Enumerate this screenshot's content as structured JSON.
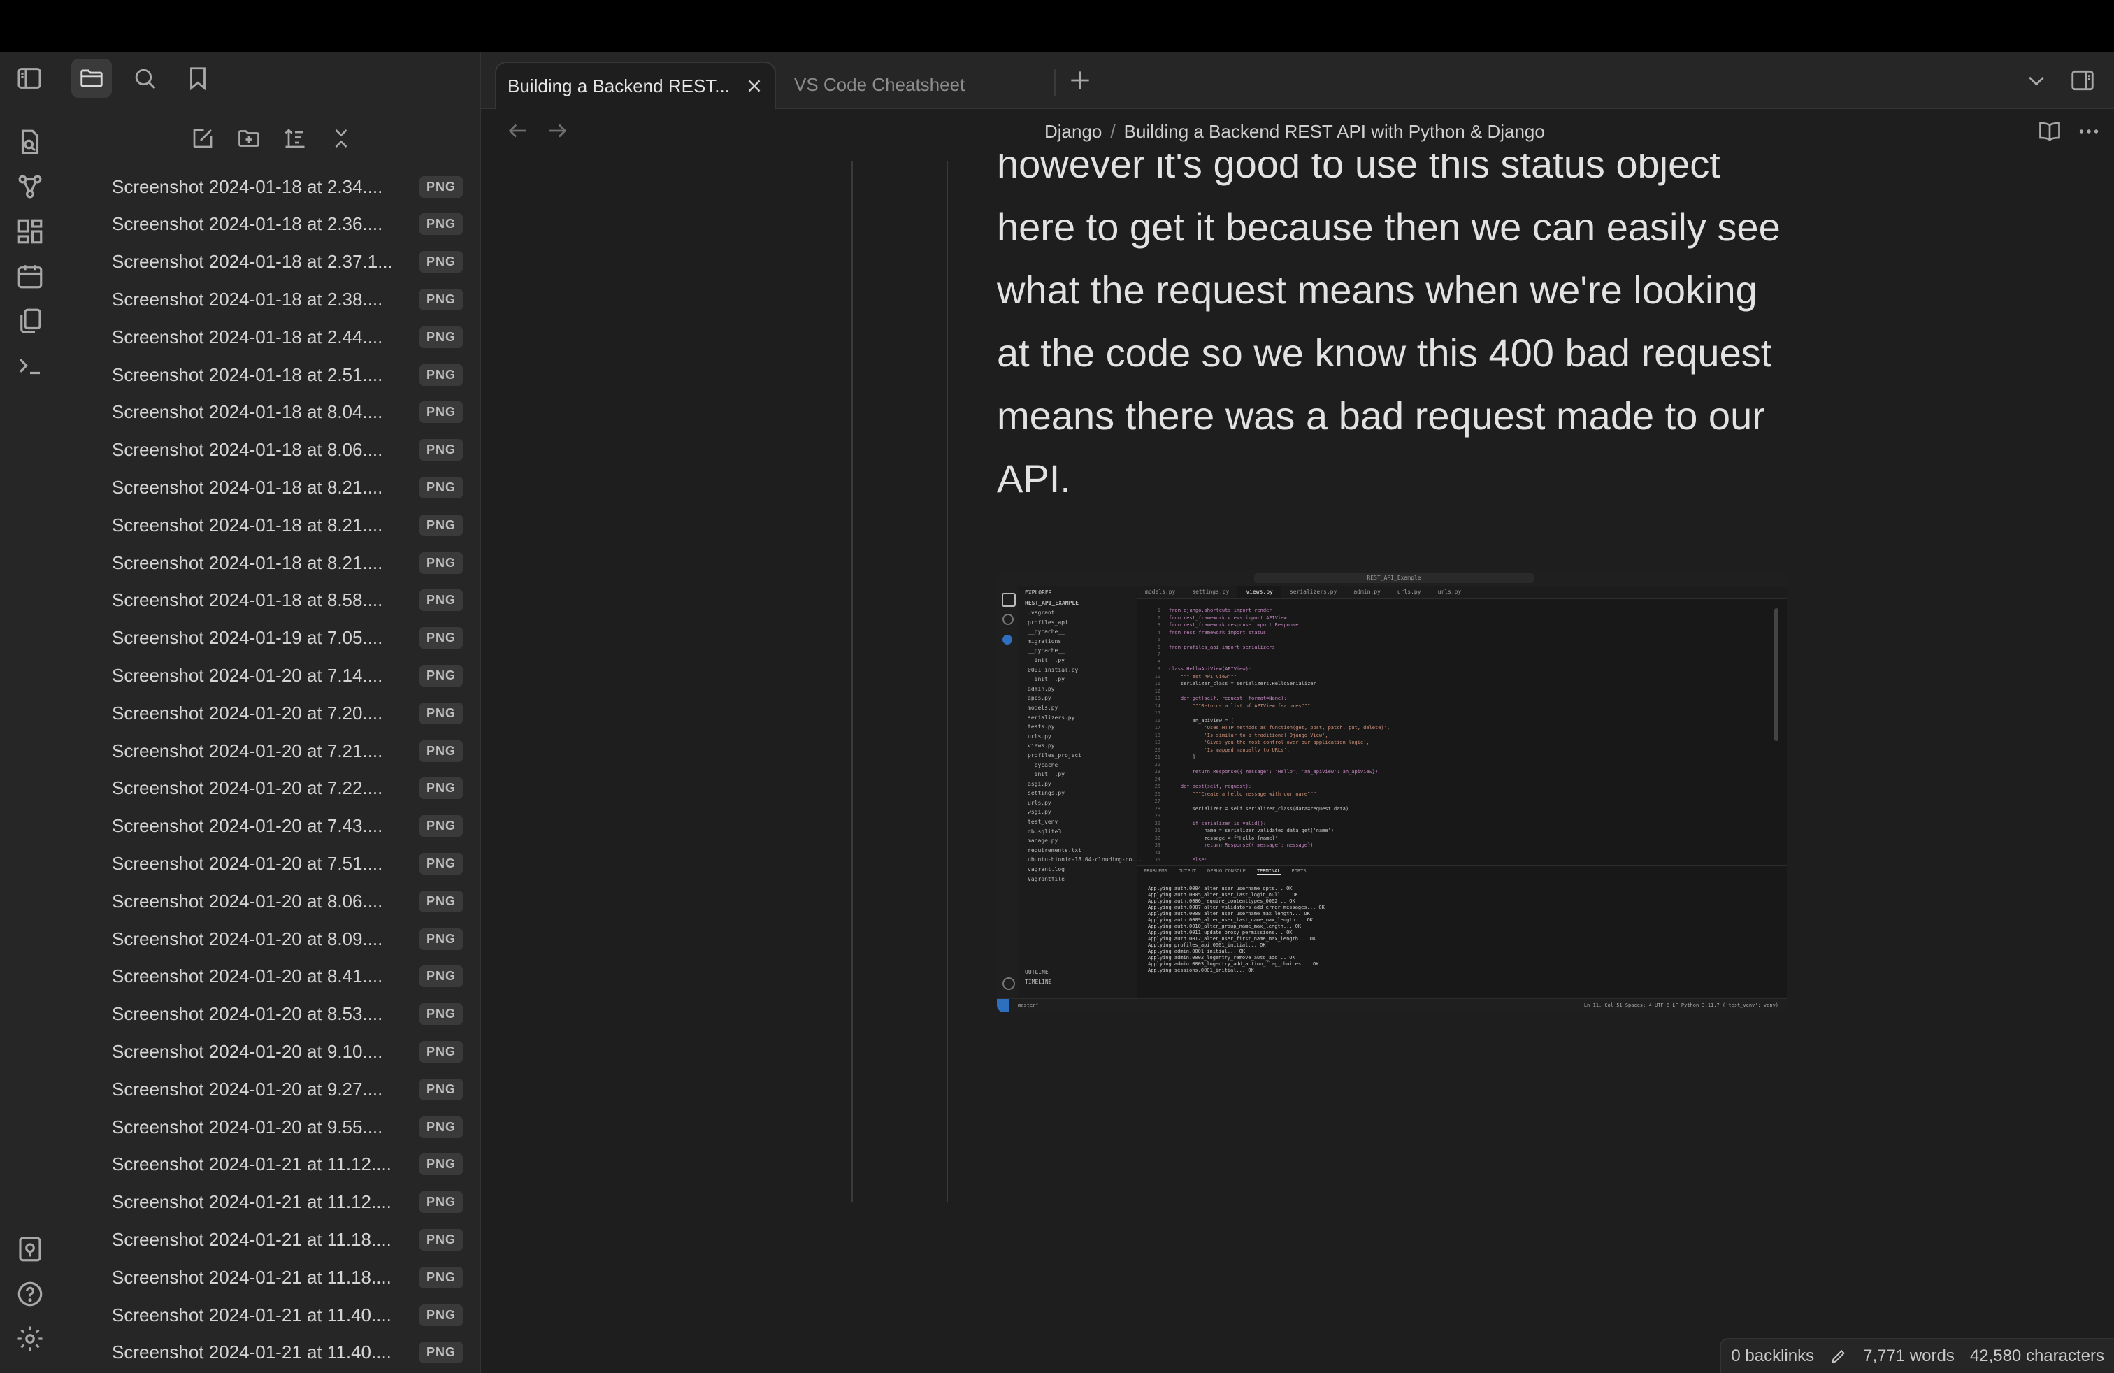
{
  "tabs": {
    "active_title": "Building a Backend REST...",
    "inactive_title": "VS Code Cheatsheet"
  },
  "breadcrumb": {
    "folder": "Django",
    "separator": "/",
    "note": "Building a Backend REST API with Python & Django"
  },
  "ribbon": {
    "top_icons": [
      "open-quick-switcher-icon",
      "graph-view-icon",
      "canvas-icon",
      "daily-note-icon",
      "templates-icon",
      "terminal-icon"
    ],
    "bottom_icons": [
      "vault-switch-icon",
      "help-icon",
      "settings-icon"
    ]
  },
  "sidebar": {
    "nav_icons": [
      "files-icon",
      "search-icon",
      "bookmark-icon"
    ],
    "toolbar_icons": [
      "new-note-icon",
      "new-folder-icon",
      "sort-icon",
      "collapse-all-icon"
    ],
    "files": [
      {
        "name": "Screenshot 2024-01-18 at 2.34....",
        "ext": "PNG"
      },
      {
        "name": "Screenshot 2024-01-18 at 2.36....",
        "ext": "PNG"
      },
      {
        "name": "Screenshot 2024-01-18 at 2.37.1...",
        "ext": "PNG"
      },
      {
        "name": "Screenshot 2024-01-18 at 2.38....",
        "ext": "PNG"
      },
      {
        "name": "Screenshot 2024-01-18 at 2.44....",
        "ext": "PNG"
      },
      {
        "name": "Screenshot 2024-01-18 at 2.51....",
        "ext": "PNG"
      },
      {
        "name": "Screenshot 2024-01-18 at 8.04....",
        "ext": "PNG"
      },
      {
        "name": "Screenshot 2024-01-18 at 8.06....",
        "ext": "PNG"
      },
      {
        "name": "Screenshot 2024-01-18 at 8.21....",
        "ext": "PNG"
      },
      {
        "name": "Screenshot 2024-01-18 at 8.21....",
        "ext": "PNG"
      },
      {
        "name": "Screenshot 2024-01-18 at 8.21....",
        "ext": "PNG"
      },
      {
        "name": "Screenshot 2024-01-18 at 8.58....",
        "ext": "PNG"
      },
      {
        "name": "Screenshot 2024-01-19 at 7.05....",
        "ext": "PNG"
      },
      {
        "name": "Screenshot 2024-01-20 at 7.14....",
        "ext": "PNG"
      },
      {
        "name": "Screenshot 2024-01-20 at 7.20....",
        "ext": "PNG"
      },
      {
        "name": "Screenshot 2024-01-20 at 7.21....",
        "ext": "PNG"
      },
      {
        "name": "Screenshot 2024-01-20 at 7.22....",
        "ext": "PNG"
      },
      {
        "name": "Screenshot 2024-01-20 at 7.43....",
        "ext": "PNG"
      },
      {
        "name": "Screenshot 2024-01-20 at 7.51....",
        "ext": "PNG"
      },
      {
        "name": "Screenshot 2024-01-20 at 8.06....",
        "ext": "PNG"
      },
      {
        "name": "Screenshot 2024-01-20 at 8.09....",
        "ext": "PNG"
      },
      {
        "name": "Screenshot 2024-01-20 at 8.41....",
        "ext": "PNG"
      },
      {
        "name": "Screenshot 2024-01-20 at 8.53....",
        "ext": "PNG"
      },
      {
        "name": "Screenshot 2024-01-20 at 9.10....",
        "ext": "PNG"
      },
      {
        "name": "Screenshot 2024-01-20 at 9.27....",
        "ext": "PNG"
      },
      {
        "name": "Screenshot 2024-01-20 at 9.55....",
        "ext": "PNG"
      },
      {
        "name": "Screenshot 2024-01-21 at 11.12....",
        "ext": "PNG"
      },
      {
        "name": "Screenshot 2024-01-21 at 11.12....",
        "ext": "PNG"
      },
      {
        "name": "Screenshot 2024-01-21 at 11.18....",
        "ext": "PNG"
      },
      {
        "name": "Screenshot 2024-01-21 at 11.18....",
        "ext": "PNG"
      },
      {
        "name": "Screenshot 2024-01-21 at 11.40....",
        "ext": "PNG"
      },
      {
        "name": "Screenshot 2024-01-21 at 11.40....",
        "ext": "PNG"
      }
    ]
  },
  "note": {
    "paragraph": "however it's good to use this status object here to get it because then we can easily see what the request means when we're looking at the code so we know this 400 bad request means there was a bad request made to our API."
  },
  "embedded_screenshot": {
    "window_title": "REST_API_Example",
    "explorer_title": "EXPLORER",
    "project_root": "REST_API_EXAMPLE",
    "editor_tabs": [
      "models.py",
      "settings.py",
      "views.py",
      "serializers.py",
      "admin.py",
      "urls.py",
      "urls.py"
    ],
    "tree": [
      ".vagrant",
      "profiles_api",
      "__pycache__",
      "migrations",
      "__pycache__",
      "__init__.py",
      "0001_initial.py",
      "__init__.py",
      "admin.py",
      "apps.py",
      "models.py",
      "serializers.py",
      "tests.py",
      "urls.py",
      "views.py",
      "profiles_project",
      "__pycache__",
      "__init__.py",
      "asgi.py",
      "settings.py",
      "urls.py",
      "wsgi.py",
      "test_venv",
      "db.sqlite3",
      "manage.py",
      "requirements.txt",
      "ubuntu-bionic-18.04-cloudimg-co...",
      "vagrant.log",
      "Vagrantfile"
    ],
    "code_lines": [
      "from django.shortcuts import render",
      "from rest_framework.views import APIView",
      "from rest_framework.response import Response",
      "from rest_framework import status",
      "",
      "from profiles_api import serializers",
      "",
      "",
      "class HelloApiView(APIView):",
      "    \"\"\"Test API View\"\"\"",
      "    serializer_class = serializers.HelloSerializer",
      "",
      "    def get(self, request, format=None):",
      "        \"\"\"Returns a list of APIView features\"\"\"",
      "",
      "        an_apiview = [",
      "            'Uses HTTP methods as function(get, post, patch, put, delete)',",
      "            'Is similar to a traditional Django View',",
      "            'Gives you the most control over our application logic',",
      "            'Is mapped manually to URLs',",
      "        ]",
      "",
      "        return Response({'message': 'Hello', 'an_apiview': an_apiview})",
      "",
      "    def post(self, request):",
      "        \"\"\"Create a hello message with our name\"\"\"",
      "",
      "        serializer = self.serializer_class(data=request.data)",
      "",
      "        if serializer.is_valid():",
      "            name = serializer.validated_data.get('name')",
      "            message = f'Hello {name}'",
      "            return Response({'message': message})",
      "",
      "        else:"
    ],
    "panel_tabs": [
      "PROBLEMS",
      "OUTPUT",
      "DEBUG CONSOLE",
      "TERMINAL",
      "PORTS"
    ],
    "terminal_lines": [
      "Applying auth.0004_alter_user_username_opts... OK",
      "Applying auth.0005_alter_user_last_login_null... OK",
      "Applying auth.0006_require_contenttypes_0002... OK",
      "Applying auth.0007_alter_validators_add_error_messages... OK",
      "Applying auth.0008_alter_user_username_max_length... OK",
      "Applying auth.0009_alter_user_last_name_max_length... OK",
      "Applying auth.0010_alter_group_name_max_length... OK",
      "Applying auth.0011_update_proxy_permissions... OK",
      "Applying auth.0012_alter_user_first_name_max_length... OK",
      "Applying profiles_api.0001_initial... OK",
      "Applying admin.0001_initial... OK",
      "Applying admin.0002_logentry_remove_auto_add... OK",
      "Applying admin.0003_logentry_add_action_flag_choices... OK",
      "Applying sessions.0001_initial... OK"
    ],
    "outline_labels": [
      "OUTLINE",
      "TIMELINE"
    ],
    "status_left": "master*",
    "status_right": "Ln 11, Col 51   Spaces: 4   UTF-8   LF   Python   3.11.7 ('test_venv': venv)"
  },
  "status": {
    "backlinks": "0 backlinks",
    "words": "7,771 words",
    "characters": "42,580 characters"
  },
  "colors": {
    "background": "#1e1e1e",
    "panel": "#262626",
    "text": "#dadada",
    "muted": "#8c8c8c"
  }
}
